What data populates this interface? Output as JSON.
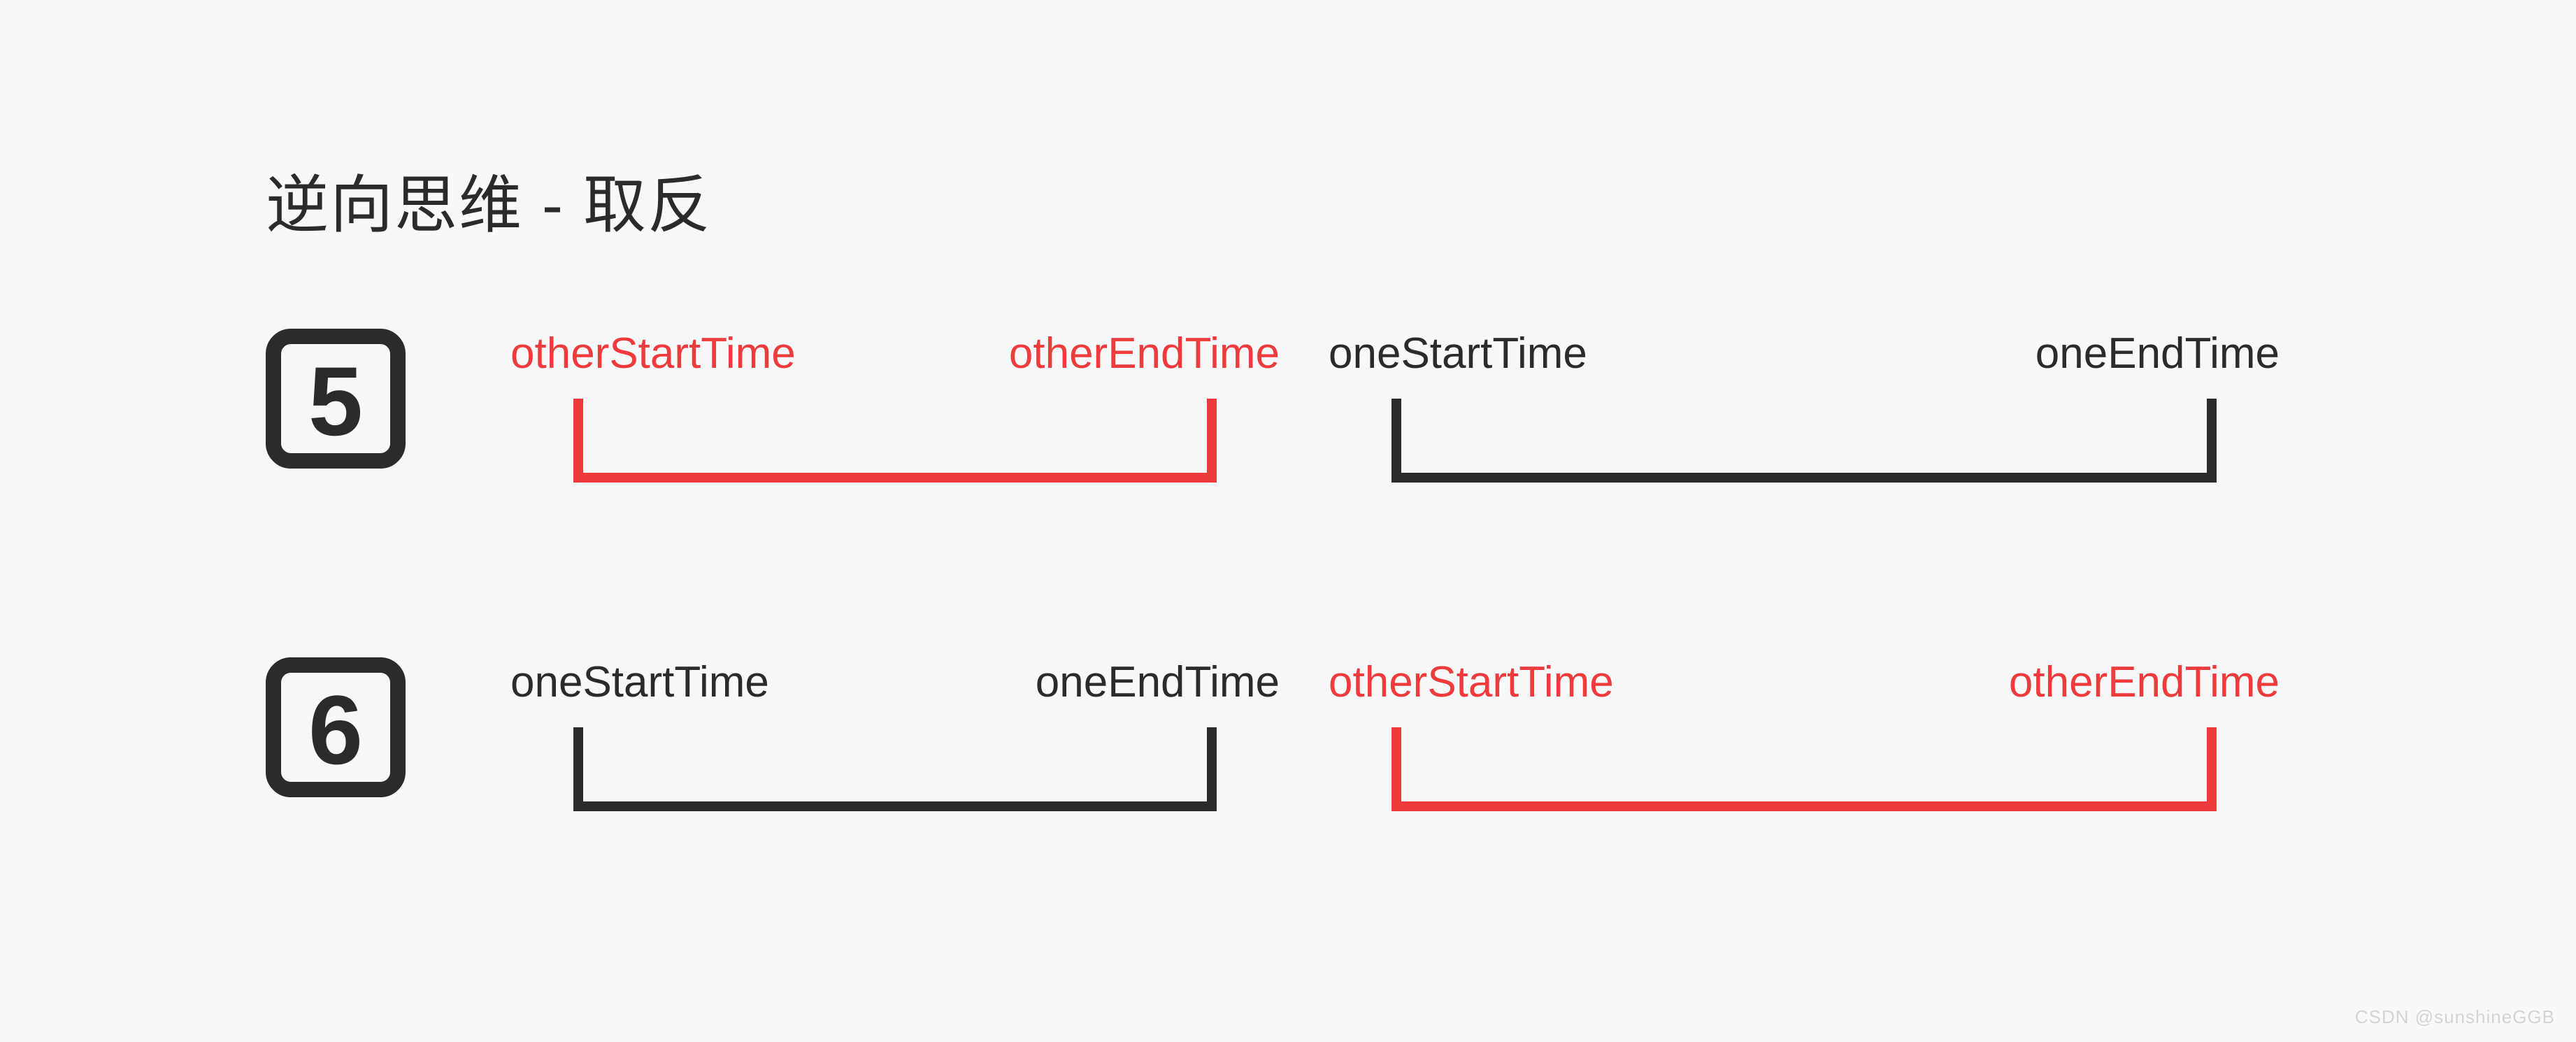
{
  "title": "逆向思维 - 取反",
  "rows": [
    {
      "badge": "5",
      "intervals": [
        {
          "startLabel": "otherStartTime",
          "endLabel": "otherEndTime",
          "color": "red"
        },
        {
          "startLabel": "oneStartTime",
          "endLabel": "oneEndTime",
          "color": "black"
        }
      ]
    },
    {
      "badge": "6",
      "intervals": [
        {
          "startLabel": "oneStartTime",
          "endLabel": "oneEndTime",
          "color": "black"
        },
        {
          "startLabel": "otherStartTime",
          "endLabel": "otherEndTime",
          "color": "red"
        }
      ]
    }
  ],
  "watermark": "CSDN @sunshineGGB"
}
